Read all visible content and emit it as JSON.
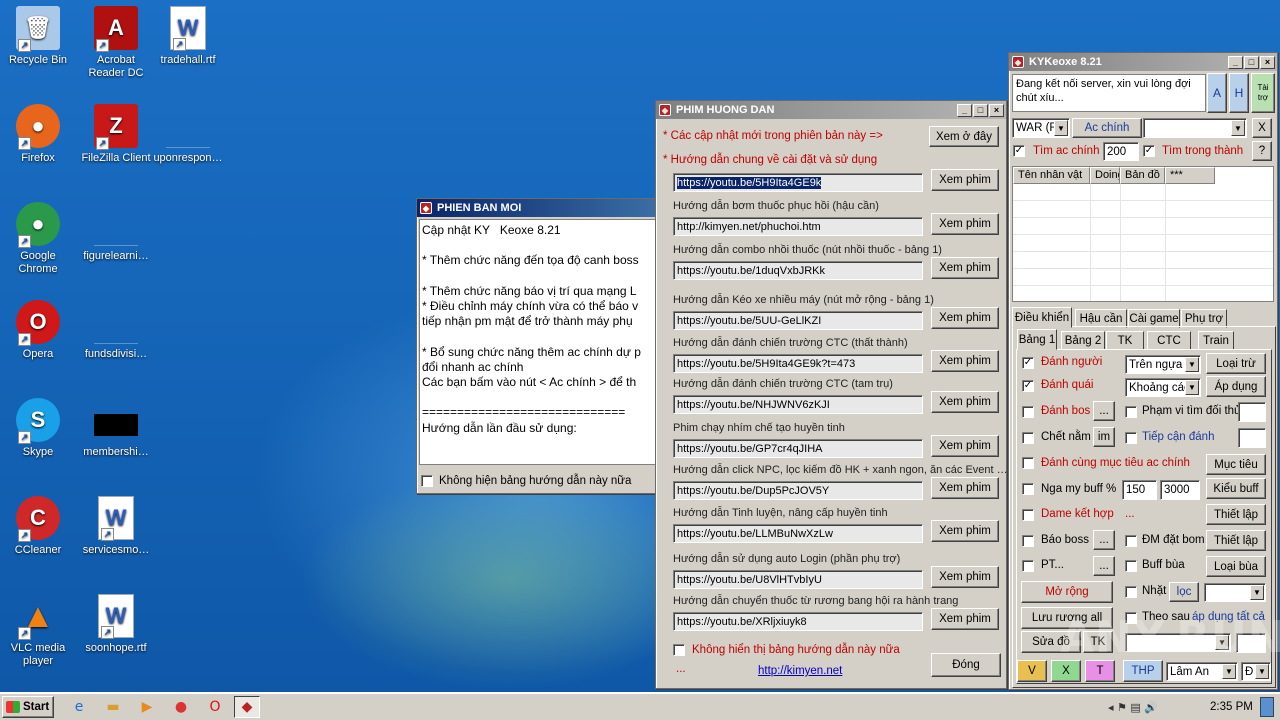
{
  "desktop_icons": [
    {
      "label": "Recycle Bin",
      "icon": "recycle-bin-icon",
      "glyph": "🗑"
    },
    {
      "label": "Acrobat Reader DC",
      "icon": "acrobat-icon",
      "glyph": "A"
    },
    {
      "label": "tradehall.rtf",
      "icon": "word-doc-icon",
      "glyph": "W"
    },
    {
      "label": "Firefox",
      "icon": "firefox-icon",
      "glyph": "●"
    },
    {
      "label": "FileZilla Client",
      "icon": "filezilla-icon",
      "glyph": "Z"
    },
    {
      "label": "uponrespon…",
      "icon": "file-icon",
      "glyph": ""
    },
    {
      "label": "Google Chrome",
      "icon": "chrome-icon",
      "glyph": "●"
    },
    {
      "label": "figurelearni…",
      "icon": "file-icon",
      "glyph": ""
    },
    {
      "label": "Opera",
      "icon": "opera-icon",
      "glyph": "O"
    },
    {
      "label": "fundsdivisi…",
      "icon": "file-icon",
      "glyph": ""
    },
    {
      "label": "Skype",
      "icon": "skype-icon",
      "glyph": "S"
    },
    {
      "label": "membershi…",
      "icon": "black-file-icon",
      "glyph": ""
    },
    {
      "label": "CCleaner",
      "icon": "ccleaner-icon",
      "glyph": "C"
    },
    {
      "label": "servicesmo…",
      "icon": "word-doc-icon",
      "glyph": "W"
    },
    {
      "label": "VLC media player",
      "icon": "vlc-icon",
      "glyph": "▲"
    },
    {
      "label": "soonhope.rtf",
      "icon": "word-doc-icon",
      "glyph": "W"
    }
  ],
  "phien_ban_moi": {
    "title": "PHIEN BAN MOI",
    "lines": [
      "Cập nhật KY   Keoxe 8.21",
      "",
      "* Thêm chức năng đến tọa độ canh boss",
      "",
      "* Thêm chức năng báo vị trí qua mạng L",
      "* Điều chỉnh máy chính vừa có thể báo v",
      "tiếp nhận pm mật để trở thành máy phụ",
      "",
      "* Bổ sung chức năng thêm ac chính dự p",
      "đổi nhanh ac chính",
      "Các bạn bấm vào nút < Ac chính > để th",
      "",
      "=============================",
      "Hướng dẫn lần đầu sử dụng:"
    ],
    "checkbox_label": "Không hiện bảng hướng dẫn này nữa"
  },
  "phim_huong_dan": {
    "title": "PHIM HUONG DAN",
    "updates_label": "* Các cập nhật mới trong phiên bản này =>",
    "updates_button": "Xem ở đây",
    "general_label": "* Hướng dẫn chung về cài đặt và sử dụng",
    "video_button": "Xem phim",
    "videos": [
      {
        "label": "",
        "url": "https://youtu.be/5H9Ita4GE9k"
      },
      {
        "label": "Hướng dẫn bơm thuốc phục hồi (hậu cần)",
        "url": "http://kimyen.net/phuchoi.htm"
      },
      {
        "label": "Hướng dẫn combo nhồi thuốc (nút nhồi thuốc - bảng 1)",
        "url": "https://youtu.be/1duqVxbJRKk"
      },
      {
        "label": "Hướng dẫn Kéo xe nhiều máy (nút mở rộng - bảng 1)",
        "url": "https://youtu.be/5UU-GeLlKZI"
      },
      {
        "label": "Hướng dẫn đánh chiến trường CTC (thất thành)",
        "url": "https://youtu.be/5H9Ita4GE9k?t=473"
      },
      {
        "label": "Hướng dẫn đánh chiến trường CTC (tam trụ)",
        "url": "https://youtu.be/NHJWNV6zKJI"
      },
      {
        "label": "Phim chạy nhím chế tạo huyền tinh",
        "url": "https://youtu.be/GP7cr4qJIHA"
      },
      {
        "label": "Hướng dẫn click NPC, lọc kiếm đồ HK + xanh ngon, ăn các Event …",
        "url": "https://youtu.be/Dup5PcJOV5Y"
      },
      {
        "label": "Hướng dẫn Tinh luyện, nâng cấp huyền tinh",
        "url": "https://youtu.be/LLMBuNwXzLw"
      },
      {
        "label": "Hướng dẫn sử dụng auto Login (phần phụ trợ)",
        "url": "https://youtu.be/U8VlHTvbIyU"
      },
      {
        "label": "Hướng dẫn chuyển thuốc từ rương bang hội ra hành trang",
        "url": "https://youtu.be/XRljxiuyk8"
      }
    ],
    "checkbox_label": "Không hiển thị bảng hướng dẫn này nữa",
    "dots": "...",
    "link": "http://kimyen.net",
    "close_button": "Đóng"
  },
  "kykeoxe": {
    "title": "KYKeoxe 8.21",
    "status": "Đang kết nối server, xin vui lòng đợi chút xíu...",
    "btn_a": "A",
    "btn_h": "H",
    "btn_taitro": "Tài trợ",
    "war_select": "WAR (F",
    "ac_chinh": "Ac chính",
    "x_button": "X",
    "tim_ac_chinh": "Tìm ac chính",
    "tim_value": "200",
    "tim_trong_thanh": "Tìm trong thành",
    "help_button": "?",
    "columns": [
      "Tên nhân vật",
      "Doing",
      "Bản đồ",
      "***"
    ],
    "main_tabs": [
      "Điều khiển",
      "Hậu cần",
      "Cài game",
      "Phụ trợ"
    ],
    "sub_tabs": [
      "Bảng 1",
      "Bảng 2",
      "TK",
      "CTC",
      "Train"
    ],
    "danh_nguoi": "Đánh người",
    "tren_ngua": "Trên ngựa",
    "loai_tru": "Loại trừ",
    "danh_quai": "Đánh quái",
    "khoang_cach": "Khoảng các",
    "ap_dung": "Áp dụng",
    "danh_bos": "Đánh bos",
    "dots_btn": "...",
    "pham_vi": "Phạm vi tìm đối thủ",
    "chet_nam": "Chết nằm",
    "im_btn": "im",
    "tiep_can": "Tiếp cận đánh",
    "danh_cung": "Đánh cùng mục tiêu ac chính",
    "muc_tieu": "Mục tiêu",
    "nga_my_buff": "Nga my buff %",
    "buff_v1": "150",
    "buff_v2": "3000",
    "kieu_buff": "Kiểu buff",
    "dame_ket_hop": "Dame kết hợp",
    "dame_dots": "...",
    "thiet_lap": "Thiết lập",
    "bao_boss": "Báo boss",
    "dm_dat_bom": "ĐM đặt bom",
    "pt": "PT...",
    "buff_bua": "Buff bùa",
    "loai_bua": "Loại bùa",
    "mo_rong": "Mở rộng",
    "nhat": "Nhặt",
    "loc": "lọc",
    "luu_ruong": "Lưu rương all",
    "theo_sau": "Theo sau",
    "ap_dung_tat_ca": "áp dụng tất cả",
    "sua_do": "Sửa đồ",
    "tk_btn": "TK",
    "bottom_v": "V",
    "bottom_x": "X",
    "bottom_t": "T",
    "bottom_thp": "THP",
    "lam_an": "Lâm An",
    "d_select": "Đ"
  },
  "taskbar": {
    "start": "Start",
    "clock": "2:35 PM"
  },
  "watermark": "ANY.RUN"
}
